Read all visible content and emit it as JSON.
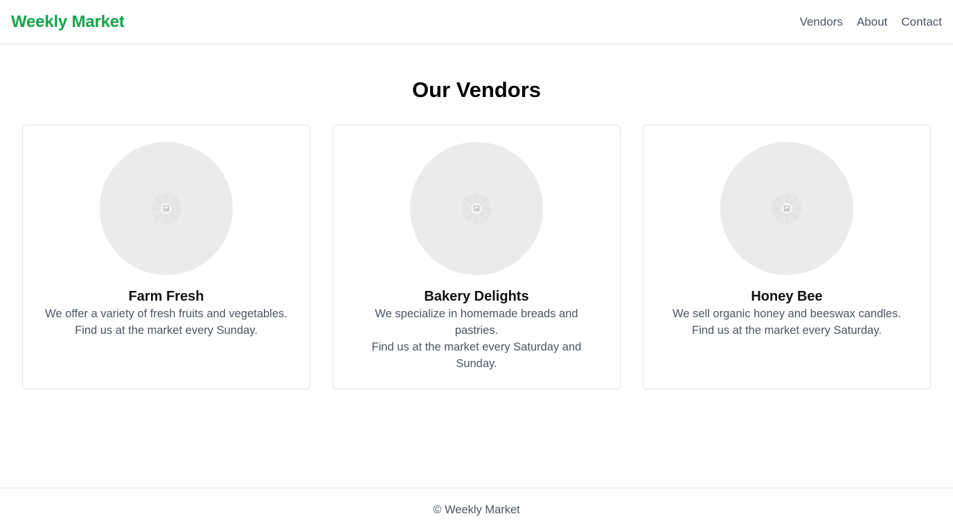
{
  "header": {
    "brand": "Weekly Market",
    "nav": [
      {
        "label": "Vendors"
      },
      {
        "label": "About"
      },
      {
        "label": "Contact"
      }
    ]
  },
  "main": {
    "title": "Our Vendors",
    "vendors": [
      {
        "name": "Farm Fresh",
        "description": "We offer a variety of fresh fruits and vegetables.",
        "schedule": "Find us at the market every Sunday.",
        "image_icon": "image-placeholder-icon"
      },
      {
        "name": "Bakery Delights",
        "description": "We specialize in homemade breads and pastries.",
        "schedule": "Find us at the market every Saturday and Sunday.",
        "image_icon": "image-placeholder-icon"
      },
      {
        "name": "Honey Bee",
        "description": "We sell organic honey and beeswax candles.",
        "schedule": "Find us at the market every Saturday.",
        "image_icon": "image-placeholder-icon"
      }
    ]
  },
  "footer": {
    "copyright": "© Weekly Market"
  },
  "colors": {
    "brand": "#16a34a",
    "muted_text": "#4b5563",
    "border": "#e5e7eb",
    "placeholder": "#ebebeb"
  }
}
